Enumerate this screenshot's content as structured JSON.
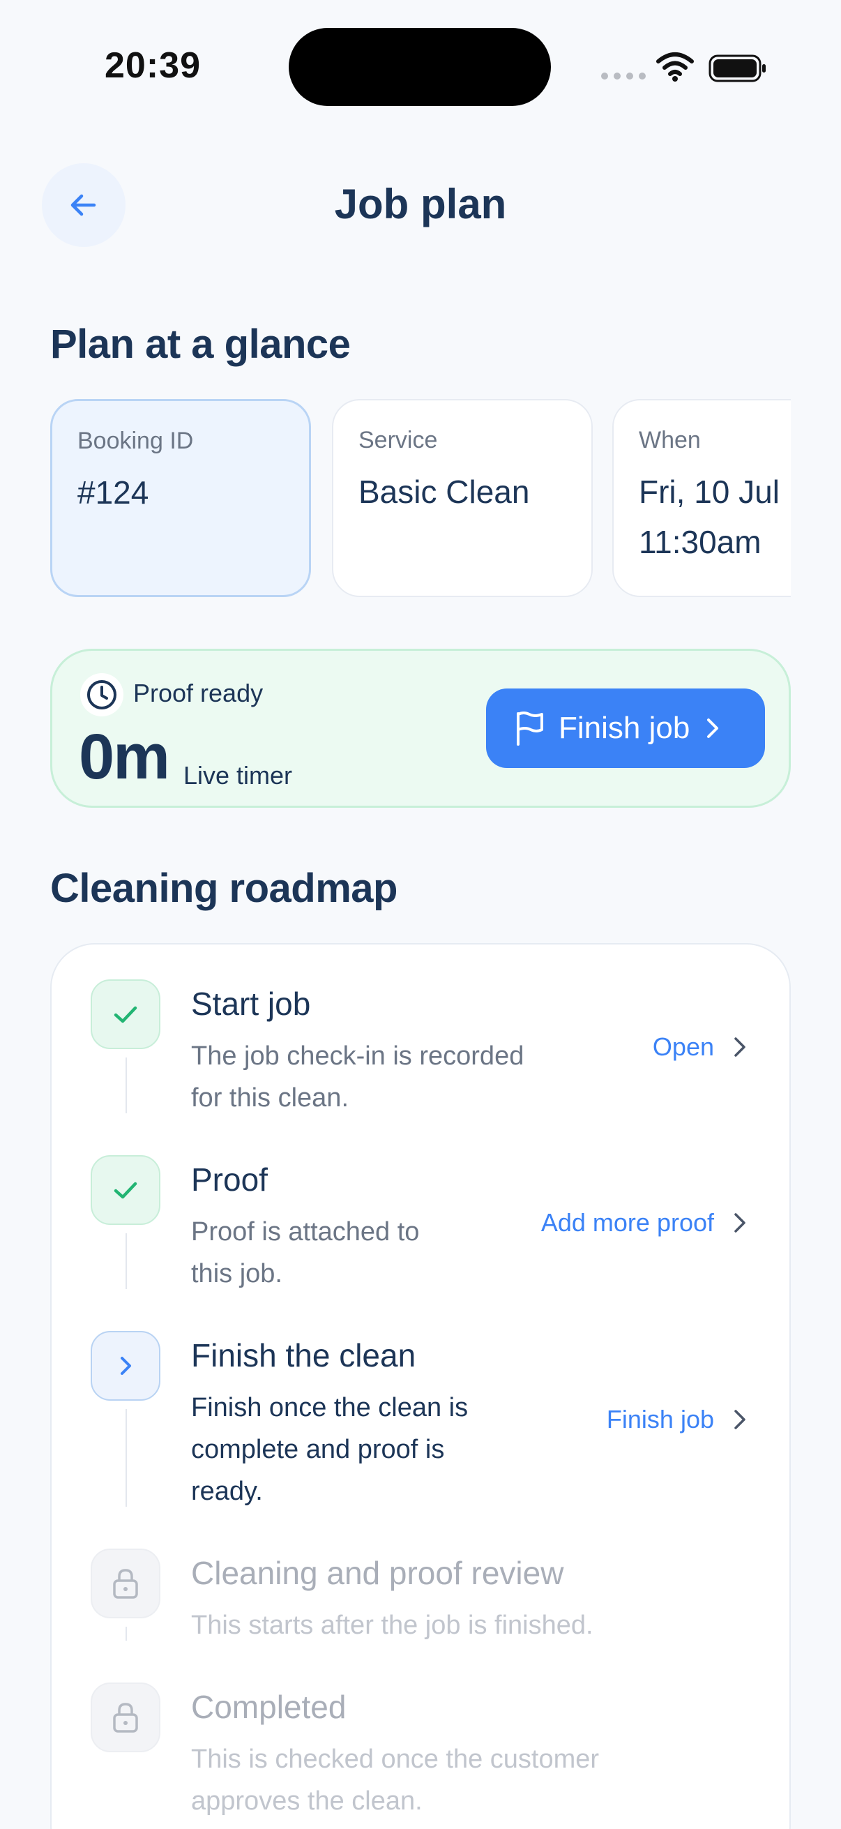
{
  "status_bar": {
    "time": "20:39"
  },
  "header": {
    "title": "Job plan"
  },
  "glance": {
    "section_title": "Plan at a glance",
    "cards": [
      {
        "label": "Booking ID",
        "value": "#124"
      },
      {
        "label": "Service",
        "value": "Basic Clean"
      },
      {
        "label": "When",
        "value_line1": "Fri, 10 Jul",
        "value_line2": "11:30am"
      }
    ]
  },
  "timer": {
    "status": "Proof ready",
    "value": "0m",
    "sublabel": "Live timer",
    "button_label": "Finish job"
  },
  "roadmap": {
    "section_title": "Cleaning roadmap",
    "steps": [
      {
        "title": "Start job",
        "desc_line1": "The job check-in is recorded",
        "desc_line2": "for this clean.",
        "action": "Open",
        "state": "done"
      },
      {
        "title": "Proof",
        "desc_line1": "Proof is attached to",
        "desc_line2": "this job.",
        "action": "Add more proof",
        "state": "done"
      },
      {
        "title": "Finish the clean",
        "desc_line1": "Finish once the clean is",
        "desc_line2": "complete and proof is",
        "desc_line3": "ready.",
        "action": "Finish job",
        "state": "current"
      },
      {
        "title": "Cleaning and proof review",
        "desc_line1": "This starts after the job is finished.",
        "state": "locked"
      },
      {
        "title": "Completed",
        "desc_line1": "This is checked once the customer",
        "desc_line2": "approves the clean.",
        "state": "locked"
      }
    ]
  },
  "colors": {
    "accent": "#3b82f6",
    "navy": "#1c3557",
    "success": "#22b573",
    "muted": "#6b7585"
  }
}
